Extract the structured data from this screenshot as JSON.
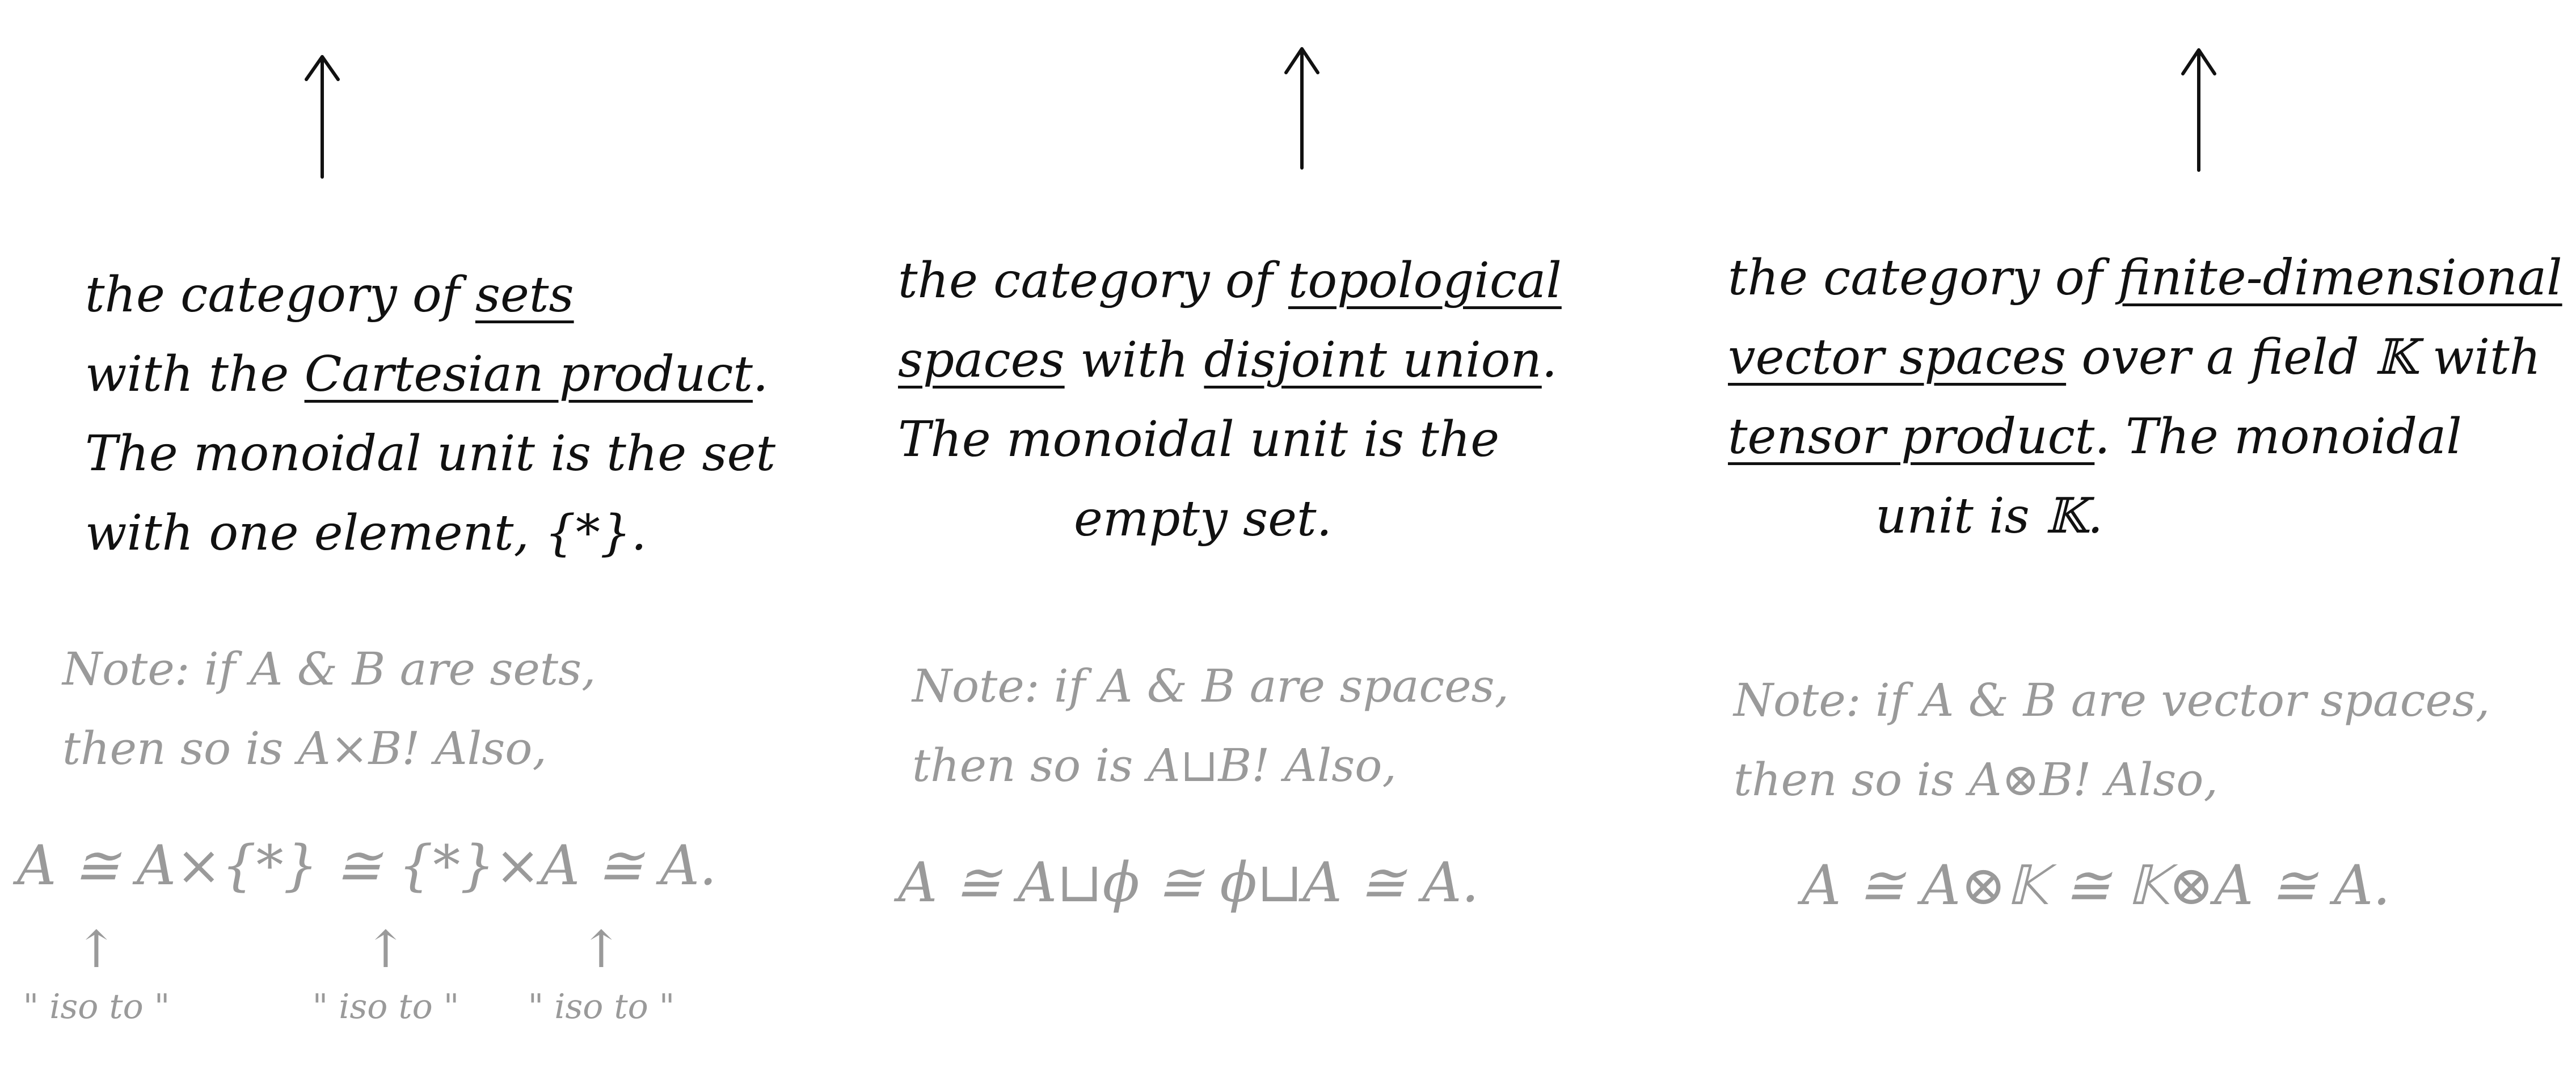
{
  "panels": [
    {
      "line1a": "the category of ",
      "term1": "sets",
      "line2a": "with the ",
      "term2": "Cartesian product",
      "line2b": ".",
      "line3": "The monoidal unit is the set",
      "line4": "with one element, {*}.",
      "note_line1": "Note: if A & B are sets,",
      "note_line2": "then so is A×B! Also,",
      "iso_equation": "A ≅ A×{*} ≅ {*}×A ≅ A.",
      "iso_label": "\" iso to \""
    },
    {
      "line1a": "the category of ",
      "term1a": "topological",
      "term1b": "spaces",
      "line2a": " with ",
      "term2": "disjoint union",
      "line2b": ".",
      "line3": "The monoidal unit is the",
      "line4": "empty set.",
      "note_line1": "Note: if A & B are spaces,",
      "note_line2": "then so is A⊔B! Also,",
      "iso_equation": "A ≅ A⊔ϕ ≅ ϕ⊔A ≅ A."
    },
    {
      "line1a": "the category of ",
      "term1a": "finite-dimensional",
      "term1b": "vector spaces",
      "line2a": " over a field 𝕂 with",
      "term2": "tensor product",
      "line3a": ". The monoidal",
      "line4": "unit is 𝕂.",
      "note_line1": "Note: if A & B are vector spaces,",
      "note_line2": "then so is A⊗B! Also,",
      "iso_equation": "A ≅ A⊗𝕂 ≅ 𝕂⊗A ≅ A."
    }
  ],
  "colors": {
    "ink": "#111111",
    "pencil": "#9a9a9a"
  },
  "icons": [
    "up-arrow-icon"
  ]
}
